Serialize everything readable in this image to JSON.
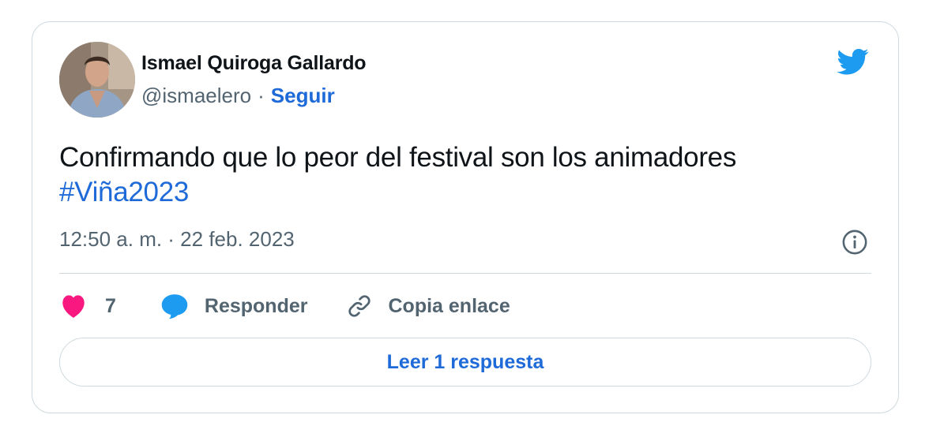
{
  "author": {
    "display_name": "Ismael Quiroga Gallardo",
    "handle": "@ismaelero",
    "separator": "·",
    "follow_label": "Seguir"
  },
  "tweet": {
    "text": "Confirmando que lo peor del festival son los animadores",
    "hashtag": "#Viña2023",
    "timestamp": "12:50 a. m. · 22 feb. 2023"
  },
  "actions": {
    "like_count": "7",
    "reply_label": "Responder",
    "copy_link_label": "Copia enlace"
  },
  "read_replies_label": "Leer 1 respuesta",
  "icons": {
    "brand": "twitter-bird-icon",
    "info": "info-icon",
    "like": "heart-icon",
    "reply": "speech-bubble-icon",
    "copy": "link-icon"
  },
  "colors": {
    "accent": "#1d6ad8",
    "twitter_blue": "#1d9bf0",
    "like": "#f91880",
    "muted_text": "#536471",
    "border": "#cfd9de"
  }
}
